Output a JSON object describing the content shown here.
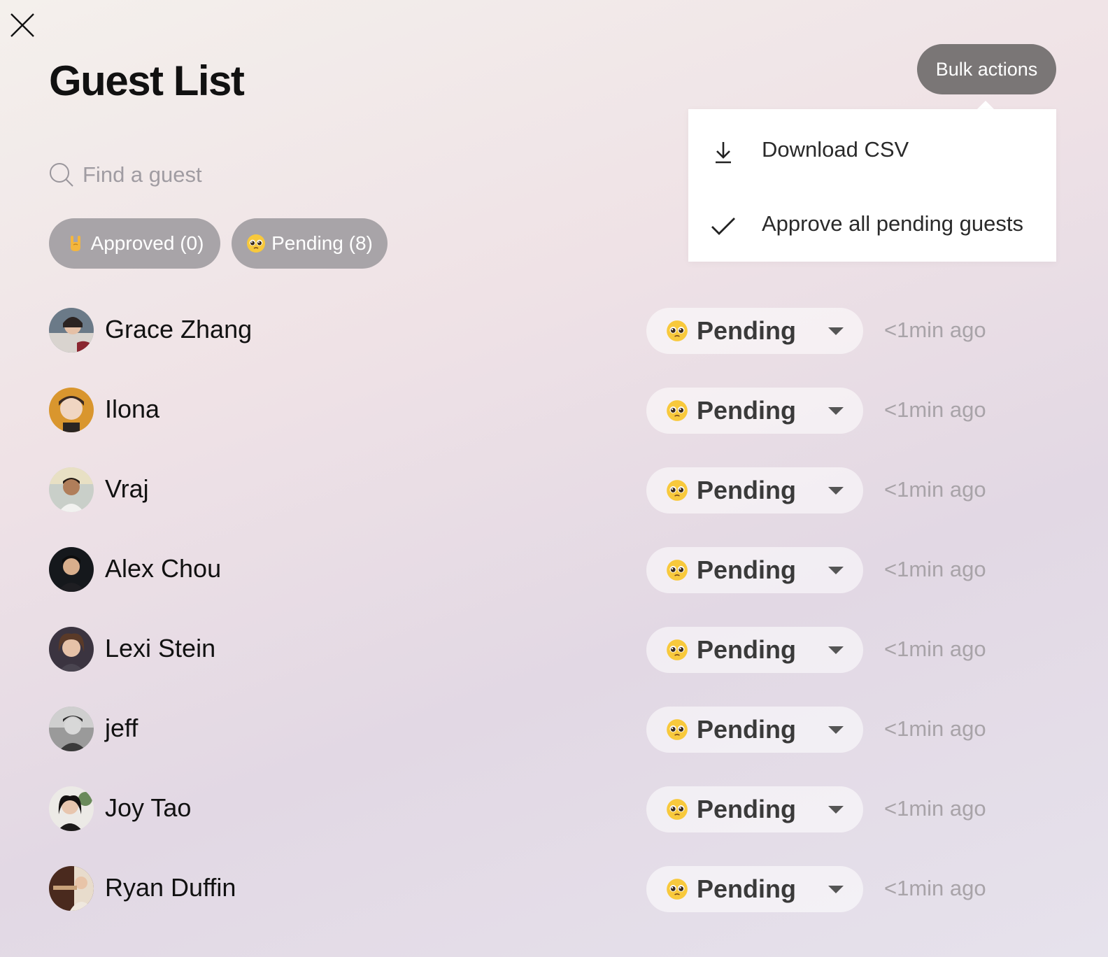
{
  "header": {
    "title": "Guest List",
    "bulk_actions_label": "Bulk actions",
    "close_icon": "close-icon"
  },
  "bulk_menu": {
    "items": [
      {
        "label": "Download CSV",
        "icon": "download-icon"
      },
      {
        "label": "Approve all pending guests",
        "icon": "checkmark-icon"
      }
    ]
  },
  "search": {
    "placeholder": "Find a guest",
    "value": "",
    "icon": "search-icon"
  },
  "filters": [
    {
      "label": "Approved (0)",
      "icon": "rock-on-hand-emoji"
    },
    {
      "label": "Pending (8)",
      "icon": "pleading-face-emoji"
    }
  ],
  "guests": [
    {
      "name": "Grace Zhang",
      "status": "Pending",
      "time": "<1min ago"
    },
    {
      "name": "Ilona",
      "status": "Pending",
      "time": "<1min ago"
    },
    {
      "name": "Vraj",
      "status": "Pending",
      "time": "<1min ago"
    },
    {
      "name": "Alex Chou",
      "status": "Pending",
      "time": "<1min ago"
    },
    {
      "name": "Lexi Stein",
      "status": "Pending",
      "time": "<1min ago"
    },
    {
      "name": "jeff",
      "status": "Pending",
      "time": "<1min ago"
    },
    {
      "name": "Joy Tao",
      "status": "Pending",
      "time": "<1min ago"
    },
    {
      "name": "Ryan Duffin",
      "status": "Pending",
      "time": "<1min ago"
    }
  ],
  "colors": {
    "bulk_button_bg": "#7a7676",
    "filter_pill_bg": "#a8a4a8",
    "muted_text": "#a8a3a8"
  }
}
